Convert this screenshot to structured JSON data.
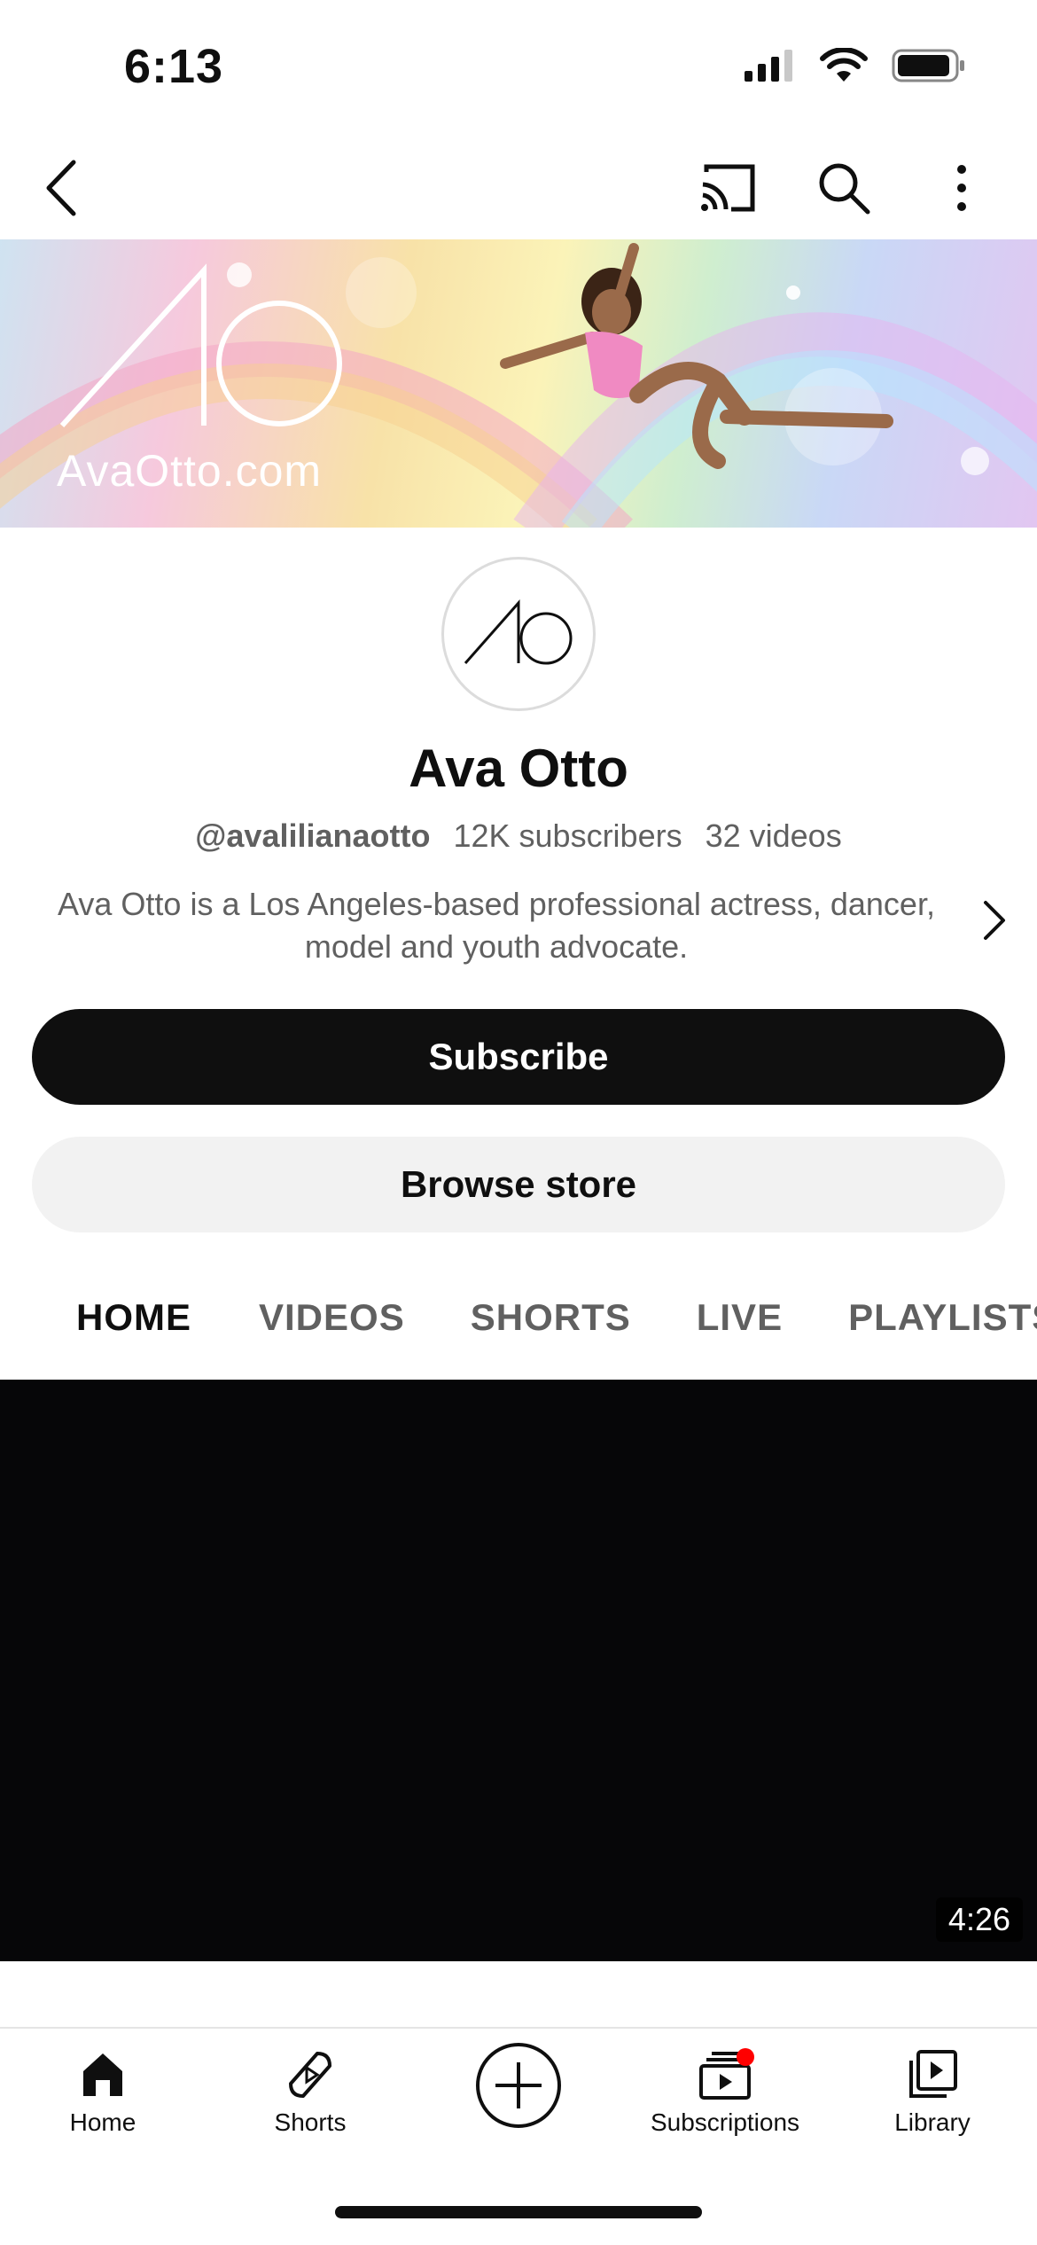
{
  "status_bar": {
    "time": "6:13",
    "icons": [
      "cellular-signal-icon",
      "wifi-icon",
      "battery-icon"
    ]
  },
  "top_nav": {
    "icons": [
      "back-icon",
      "cast-icon",
      "search-icon",
      "more-vertical-icon"
    ]
  },
  "banner": {
    "url_text": "AvaOtto.com",
    "logo": "AO"
  },
  "channel": {
    "name": "Ava Otto",
    "handle": "@avalilianaotto",
    "subscribers": "12K subscribers",
    "videos": "32 videos",
    "description_line1": "Ava Otto is a Los Angeles-based professional actress, dancer,",
    "description_line2": "model and youth advocate."
  },
  "actions": {
    "subscribe_label": "Subscribe",
    "store_label": "Browse store"
  },
  "tabs": [
    {
      "label": "HOME",
      "active": true
    },
    {
      "label": "VIDEOS",
      "active": false
    },
    {
      "label": "SHORTS",
      "active": false
    },
    {
      "label": "LIVE",
      "active": false
    },
    {
      "label": "PLAYLISTS",
      "active": false
    }
  ],
  "video": {
    "duration": "4:26"
  },
  "bottom_nav": [
    {
      "label": "Home",
      "icon": "home-icon"
    },
    {
      "label": "Shorts",
      "icon": "shorts-icon"
    },
    {
      "label": "",
      "icon": "create-plus-icon"
    },
    {
      "label": "Subscriptions",
      "icon": "subscriptions-icon"
    },
    {
      "label": "Library",
      "icon": "library-icon"
    }
  ],
  "colors": {
    "text_primary": "#0f0f0f",
    "text_secondary": "#606060",
    "subscribe_bg": "#0f0f0f",
    "store_bg": "#f2f2f2",
    "notification_dot": "#ff0000"
  }
}
